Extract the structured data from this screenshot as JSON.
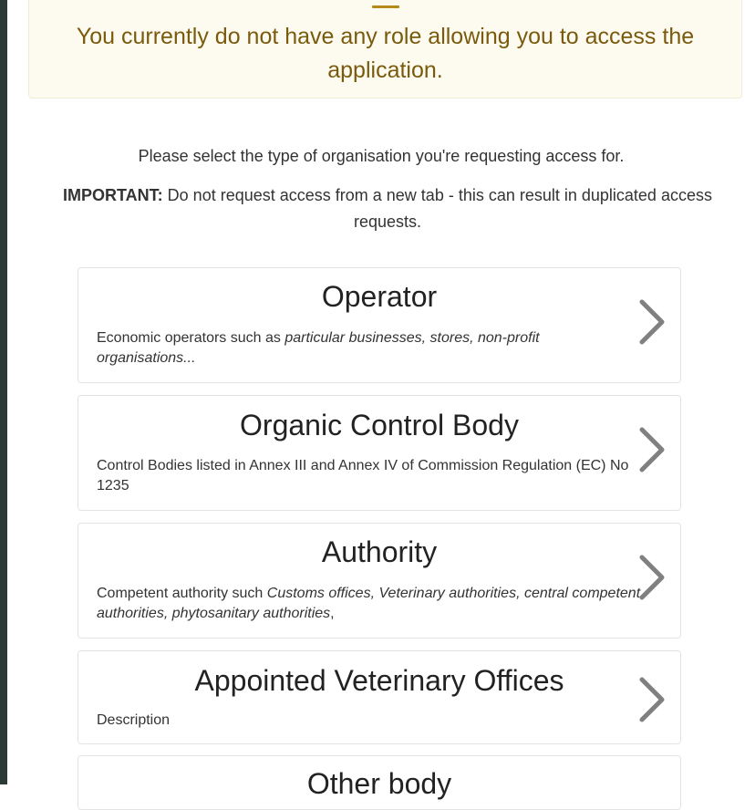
{
  "alert": {
    "icon": "warning-icon",
    "message": "You currently do not have any role allowing you to access the application."
  },
  "intro": {
    "instruction": "Please select the type of organisation you're requesting access for.",
    "important_label": "IMPORTANT:",
    "important_text": " Do not request access from a new tab - this can result in duplicated access requests."
  },
  "organisation_types": [
    {
      "title": "Operator",
      "description_prefix": "Economic operators such as ",
      "description_italic": "particular businesses, stores, non-profit organisations...",
      "description_suffix": ""
    },
    {
      "title": "Organic Control Body",
      "description_prefix": "Control Bodies listed in Annex III and Annex IV of Commission Regulation (EC) No 1235",
      "description_italic": "",
      "description_suffix": ""
    },
    {
      "title": "Authority",
      "description_prefix": "Competent authority such ",
      "description_italic": "Customs offices, Veterinary authorities, central competent authorities, phytosanitary authorities",
      "description_suffix": ","
    },
    {
      "title": "Appointed Veterinary Offices",
      "description_prefix": "Description",
      "description_italic": "",
      "description_suffix": ""
    },
    {
      "title": "Other body",
      "description_prefix": "",
      "description_italic": "",
      "description_suffix": ""
    }
  ],
  "colors": {
    "alert_background": "#fdfbf0",
    "alert_text": "#7a5a0d",
    "chevron": "#808080",
    "left_rail": "#2b3a37"
  }
}
